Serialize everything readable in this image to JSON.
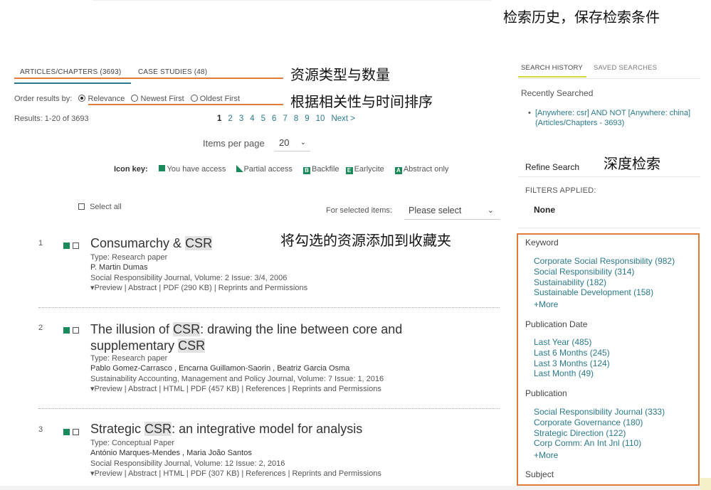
{
  "annotations": {
    "history": "检索历史，保存检索条件",
    "types": "资源类型与数量",
    "order": "根据相关性与时间排序",
    "refine": "深度检索",
    "favorites": "将勾选的资源添加到收藏夹"
  },
  "tabs": {
    "articles": "ARTICLES/CHAPTERS (3693)",
    "cases": "CASE STUDIES (48)"
  },
  "order": {
    "label": "Order results by:",
    "relevance": "Relevance",
    "newest": "Newest First",
    "oldest": "Oldest First"
  },
  "results": {
    "label": "Results: 1-20 of 3693"
  },
  "pagination": {
    "pages": [
      "1",
      "2",
      "3",
      "4",
      "5",
      "6",
      "7",
      "8",
      "9",
      "10"
    ],
    "next": "Next >"
  },
  "per_page": {
    "label": "Items per page",
    "value": "20"
  },
  "icon_key": {
    "label": "Icon key:",
    "access": "You have access",
    "partial": "Partial access",
    "backfile": "Backfile",
    "earlycite": "Earlycite",
    "abstract": "Abstract only",
    "b": "B",
    "e": "E",
    "a": "A"
  },
  "select_all": "Select all",
  "for_selected": {
    "label": "For selected items:",
    "value": "Please select"
  },
  "items": [
    {
      "num": "1",
      "t1": "Consumarchy & ",
      "t_csr": "CSR",
      "type": "Type: Research paper",
      "authors": "P. Martin Dumas",
      "source": "Social Responsibility Journal, Volume: 2 Issue: 3/4, 2006",
      "links": "▾Preview | Abstract | PDF (290 KB) | Reprints and Permissions"
    },
    {
      "num": "2",
      "t1": "The illusion of ",
      "t_csr": "CSR",
      "t2": ": drawing the line between core and",
      "l2": "supplementary ",
      "l2_csr": "CSR",
      "type": "Type: Research paper",
      "authors": "Pablo Gomez-Carrasco , Encarna Guillamon-Saorin , Beatriz Garcia Osma",
      "source": "Sustainability Accounting, Management and Policy Journal, Volume: 7 Issue: 1, 2016",
      "links": "▾Preview | Abstract | HTML | PDF (457 KB) | References | Reprints and Permissions"
    },
    {
      "num": "3",
      "t1": "Strategic ",
      "t_csr": "CSR",
      "t2": ": an integrative model for analysis",
      "type": "Type: Conceptual Paper",
      "authors": "António Marques-Mendes , Maria João Santos",
      "source": "Social Responsibility Journal, Volume: 12 Issue: 2, 2016",
      "links": "▾Preview | Abstract | HTML | PDF (307 KB) | References | Reprints and Permissions"
    }
  ],
  "sidebar": {
    "tab_history": "SEARCH HISTORY",
    "tab_saved": "SAVED SEARCHES",
    "recent_label": "Recently Searched",
    "recent_item": "[Anywhere: csr] AND NOT [Anywhere: china] (Articles/Chapters - 3693)",
    "refine": "Refine Search",
    "filters_label": "FILTERS APPLIED:",
    "filters_value": "None",
    "keyword": {
      "head": "Keyword",
      "items": [
        "Corporate Social Responsibility (982)",
        "Social Responsibility (314)",
        "Sustainability (182)",
        "Sustainable Development (158)"
      ],
      "more": "+More"
    },
    "date": {
      "head": "Publication Date",
      "items": [
        "Last Year (485)",
        "Last 6 Months (245)",
        "Last 3 Months (124)",
        "Last Month (49)"
      ]
    },
    "publication": {
      "head": "Publication",
      "items": [
        "Social Responsibility Journal (333)",
        "Corporate Governance (180)",
        "Strategic Direction (122)",
        "Corp Comm: An Int Jnl (110)"
      ],
      "more": "+More"
    },
    "subject": {
      "head": "Subject"
    }
  },
  "colors": {
    "accent": "#2a7a8c",
    "annotation_line": "#e07b39",
    "access": "#1a8a5a",
    "history_underline": "#d6d63a"
  }
}
